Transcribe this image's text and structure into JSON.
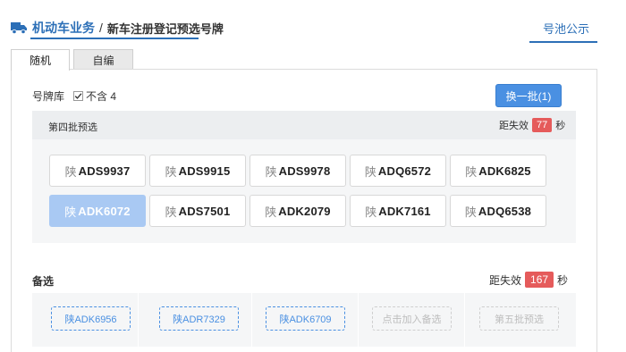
{
  "header": {
    "brand": "机动车业务",
    "separator": "/",
    "subtitle": "新车注册登记预选号牌",
    "pool_link": "号池公示"
  },
  "tabs": [
    {
      "label": "随机",
      "active": true
    },
    {
      "label": "自编",
      "active": false
    }
  ],
  "library": {
    "label": "号牌库",
    "exclude_label": "不含 4",
    "exclude_checked": true
  },
  "refresh_button": "换一批(1)",
  "batch": {
    "title": "第四批预选",
    "expire_prefix": "距失效",
    "expire_seconds": "77",
    "expire_suffix": "秒",
    "plates": [
      {
        "prov": "陕",
        "num": "ADS9937",
        "selected": false
      },
      {
        "prov": "陕",
        "num": "ADS9915",
        "selected": false
      },
      {
        "prov": "陕",
        "num": "ADS9978",
        "selected": false
      },
      {
        "prov": "陕",
        "num": "ADQ6572",
        "selected": false
      },
      {
        "prov": "陕",
        "num": "ADK6825",
        "selected": false
      },
      {
        "prov": "陕",
        "num": "ADK6072",
        "selected": true
      },
      {
        "prov": "陕",
        "num": "ADS7501",
        "selected": false
      },
      {
        "prov": "陕",
        "num": "ADK2079",
        "selected": false
      },
      {
        "prov": "陕",
        "num": "ADK7161",
        "selected": false
      },
      {
        "prov": "陕",
        "num": "ADQ6538",
        "selected": false
      }
    ]
  },
  "backup": {
    "label": "备选",
    "expire_prefix": "距失效",
    "expire_seconds": "167",
    "expire_suffix": "秒",
    "slots": [
      {
        "text": "陕ADK6956",
        "filled": true
      },
      {
        "text": "陕ADR7329",
        "filled": true
      },
      {
        "text": "陕ADK6709",
        "filled": true
      },
      {
        "text": "点击加入备选",
        "filled": false
      },
      {
        "text": "第五批预选",
        "filled": false
      }
    ]
  },
  "colors": {
    "accent": "#2c6fb7",
    "button": "#4a90e2",
    "badge": "#e55b5b",
    "selected_plate": "#a9c9f3"
  }
}
